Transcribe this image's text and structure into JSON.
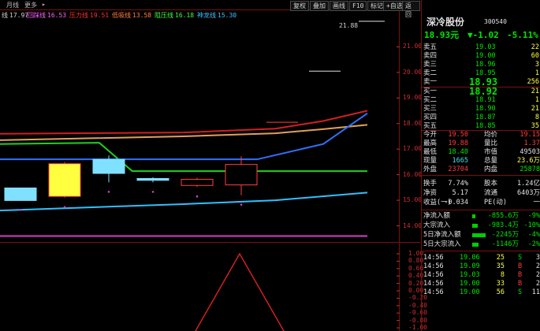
{
  "toolbar": {
    "menu_left": "月线",
    "menu_more": "更多",
    "menu_arrow": "▸",
    "buttons": [
      "复权",
      "叠加",
      "画线",
      "F10",
      "标记",
      "+自选",
      "返回"
    ]
  },
  "legend": [
    {
      "name": "线",
      "value": "17.97",
      "color": "#d0d0d0"
    },
    {
      "name": "回踩线",
      "value": "16.53",
      "color": "#ff60ff"
    },
    {
      "name": "压力线",
      "value": "19.51",
      "color": "#ff3030"
    },
    {
      "name": "低吸线",
      "value": "13.58",
      "color": "#ff8040"
    },
    {
      "name": "阻压线",
      "value": "16.18",
      "color": "#40ff40"
    },
    {
      "name": "神龙线",
      "value": "15.30",
      "color": "#40c0ff"
    }
  ],
  "chart_main": {
    "max_label": "21.88",
    "y_ticks": [
      "21.00",
      "20.00",
      "19.00",
      "18.00",
      "17.00",
      "16.00",
      "15.00",
      "14.00"
    ],
    "y_values": [
      21,
      20,
      19,
      18,
      17,
      16,
      15,
      14
    ],
    "ylim": [
      13.4,
      22.4
    ],
    "candles": [
      {
        "open": 14.99,
        "close": 15.48,
        "high": 15.48,
        "low": 14.99,
        "color": "#80e0ff",
        "fill": "#80e0ff"
      },
      {
        "open": 16.43,
        "close": 15.15,
        "high": 16.5,
        "low": 15.1,
        "color": "#ff4040",
        "fill": "#ffff40"
      },
      {
        "open": 16.05,
        "close": 16.6,
        "high": 16.75,
        "low": 15.7,
        "color": "#80e0ff",
        "fill": "#80e0ff"
      },
      {
        "open": 15.85,
        "close": 15.78,
        "high": 15.9,
        "low": 15.7,
        "color": "#80e0ff",
        "fill": "#80e0ff"
      },
      {
        "open": 15.82,
        "close": 15.58,
        "high": 15.88,
        "low": 15.52,
        "color": "#ff4040",
        "fill": "none"
      },
      {
        "open": 15.6,
        "close": 16.4,
        "high": 16.72,
        "low": 15.2,
        "color": "#ff4040",
        "fill": "none"
      }
    ],
    "series": [
      {
        "color": "#d02020",
        "points": [
          [
            0,
            17.6
          ],
          [
            0.5,
            17.65
          ],
          [
            0.75,
            17.8
          ],
          [
            0.88,
            18.1
          ],
          [
            1,
            18.5
          ]
        ]
      },
      {
        "color": "#e0a060",
        "points": [
          [
            0,
            17.35
          ],
          [
            0.5,
            17.5
          ],
          [
            0.75,
            17.62
          ],
          [
            0.88,
            17.78
          ],
          [
            1,
            17.95
          ]
        ]
      },
      {
        "color": "#20d020",
        "points": [
          [
            0,
            17.2
          ],
          [
            0.27,
            17.25
          ],
          [
            0.36,
            16.14
          ],
          [
            1,
            16.14
          ]
        ]
      },
      {
        "color": "#3070ff",
        "points": [
          [
            0,
            16.6
          ],
          [
            0.7,
            16.6
          ],
          [
            0.88,
            17.2
          ],
          [
            1,
            18.4
          ]
        ]
      },
      {
        "color": "#30c0ff",
        "points": [
          [
            0,
            14.6
          ],
          [
            0.5,
            14.85
          ],
          [
            0.75,
            15.0
          ],
          [
            1,
            15.3
          ]
        ]
      },
      {
        "color": "#d040d0",
        "points": [
          [
            0,
            13.6
          ],
          [
            1,
            13.6
          ]
        ]
      }
    ]
  },
  "chart_sub": {
    "y_ticks": [
      "1.00",
      "0.80",
      "0.60",
      "0.40",
      "0.20",
      "0.00",
      "-0.20",
      "-0.40",
      "-0.60",
      "-0.80",
      "-1.00"
    ],
    "y_values": [
      1,
      0.8,
      0.6,
      0.4,
      0.2,
      0,
      -0.2,
      -0.4,
      -0.6,
      -0.8,
      -1
    ]
  },
  "quote": {
    "name": "深冷股份",
    "code": "300540",
    "price": "18.93元",
    "change": "▼-1.02",
    "pct": "-5.11%",
    "asks": [
      {
        "label": "卖五",
        "price": "19.03",
        "vol": "22"
      },
      {
        "label": "卖四",
        "price": "19.00",
        "vol": "60"
      },
      {
        "label": "卖三",
        "price": "18.96",
        "vol": "3"
      },
      {
        "label": "卖二",
        "price": "18.95",
        "vol": "1"
      },
      {
        "label": "卖一",
        "price": "18.93",
        "vol": "256"
      }
    ],
    "bids": [
      {
        "label": "买一",
        "price": "18.92",
        "vol": "21"
      },
      {
        "label": "买二",
        "price": "18.91",
        "vol": "1"
      },
      {
        "label": "买三",
        "price": "18.90",
        "vol": "21"
      },
      {
        "label": "买四",
        "price": "18.87",
        "vol": "8"
      },
      {
        "label": "买五",
        "price": "18.85",
        "vol": "35"
      }
    ],
    "stats": [
      {
        "l1": "今开",
        "v1": "19.50",
        "l2": "均价",
        "v2": "19.15"
      },
      {
        "l1": "最高",
        "v1": "19.88",
        "l2": "量比",
        "v2": "1.37"
      },
      {
        "l1": "最低",
        "v1": "18.40",
        "l2": "市值",
        "v2": "49503"
      },
      {
        "l1": "现量",
        "v1": "1665",
        "l2": "总量",
        "v2": "23.6万"
      },
      {
        "l1": "外盘",
        "v1": "23704",
        "l2": "内盘",
        "v2": "25878"
      }
    ],
    "stats2": [
      {
        "l1": "换手",
        "v1": "7.74%",
        "l2": "股本",
        "v2": "1.24亿"
      },
      {
        "l1": "净资",
        "v1": "5.17",
        "l2": "流通",
        "v2": "6403万"
      },
      {
        "l1": "收益(一)",
        "v1": "-0.034",
        "l2": "PE(动)",
        "v2": "一"
      }
    ],
    "flows": [
      {
        "label": "净流入额",
        "value": "-855.6万",
        "pct": "-9%",
        "bar": 0.12
      },
      {
        "label": "大宗流入",
        "value": "-983.4万",
        "pct": "-10%",
        "bar": 0.22
      },
      {
        "label": "5日净流入额",
        "value": "-2245万",
        "pct": "-4%",
        "bar": 0.55
      },
      {
        "label": "5日大宗流入",
        "value": "-1146万",
        "pct": "-2%",
        "bar": 0.28
      }
    ],
    "ticks": [
      {
        "time": "14:56",
        "price": "19.06",
        "vol": "25",
        "side": "S",
        "n": "3"
      },
      {
        "time": "14:56",
        "price": "19.09",
        "vol": "35",
        "side": "B",
        "n": "2"
      },
      {
        "time": "14:56",
        "price": "19.03",
        "vol": "8",
        "side": "B",
        "n": "2"
      },
      {
        "time": "14:56",
        "price": "19.00",
        "vol": "33",
        "side": "B",
        "n": "2"
      },
      {
        "time": "14:56",
        "price": "19.00",
        "vol": "56",
        "side": "S",
        "n": "11"
      }
    ]
  }
}
